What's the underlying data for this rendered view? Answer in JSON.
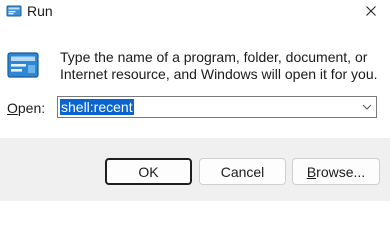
{
  "window": {
    "title": "Run",
    "title_icon": "run-icon",
    "close_icon": "close-icon"
  },
  "body": {
    "icon": "run-large-icon",
    "description": "Type the name of a program, folder, document, or Internet resource, and Windows will open it for you."
  },
  "open_field": {
    "label_accel": "O",
    "label_rest": "pen:",
    "value": "shell:recent",
    "dropdown_icon": "chevron-down-icon"
  },
  "buttons": {
    "ok": "OK",
    "cancel": "Cancel",
    "browse_accel": "B",
    "browse_rest": "rowse..."
  },
  "colors": {
    "selection": "#0a64d0",
    "footer": "#f0f0f0",
    "default_button_border": "#1f1f1f"
  }
}
